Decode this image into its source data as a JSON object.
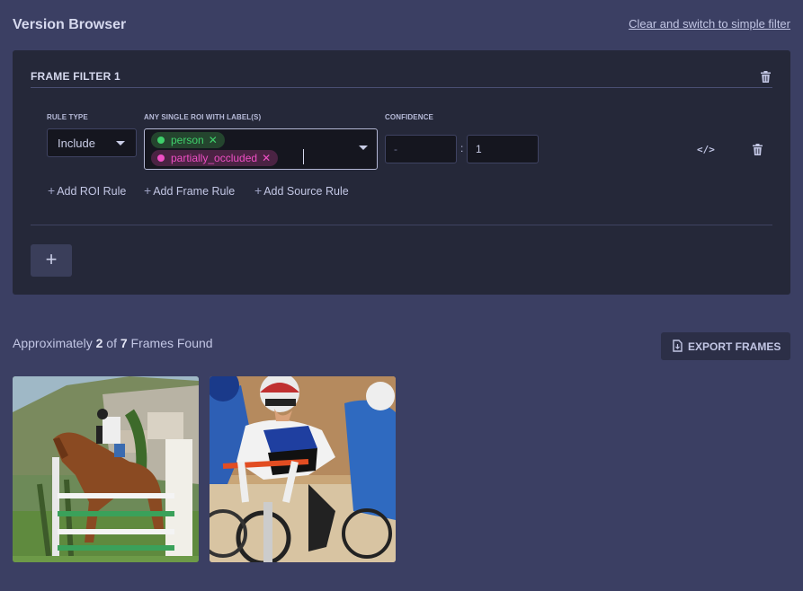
{
  "header": {
    "title": "Version Browser",
    "switch_link": "Clear and switch to simple filter"
  },
  "filter": {
    "title": "FRAME FILTER 1",
    "columns": {
      "rule_type": "RULE TYPE",
      "labels": "ANY SINGLE ROI WITH LABEL(S)",
      "confidence": "CONFIDENCE"
    },
    "rule_type_value": "Include",
    "labels": [
      {
        "text": "person",
        "color": "#3fcf6b"
      },
      {
        "text": "partially_occluded",
        "color": "#ef4fc5"
      }
    ],
    "confidence_min": "-",
    "confidence_separator": ":",
    "confidence_max": "1",
    "add_buttons": [
      "Add ROI Rule",
      "Add Frame Rule",
      "Add Source Rule"
    ],
    "add_filter_label": "+"
  },
  "results": {
    "prefix": "Approximately",
    "shown": "2",
    "of_word": "of",
    "total": "7",
    "suffix": "Frames Found",
    "export_label": "EXPORT FRAMES"
  },
  "colors": {
    "background": "#3b3f63",
    "panel": "#252839",
    "accent_person": "#3fcf6b",
    "accent_occluded": "#ef4fc5"
  },
  "icons": [
    "trash-icon",
    "chevron-down-icon",
    "code-icon",
    "plus-icon",
    "file-export-icon"
  ]
}
